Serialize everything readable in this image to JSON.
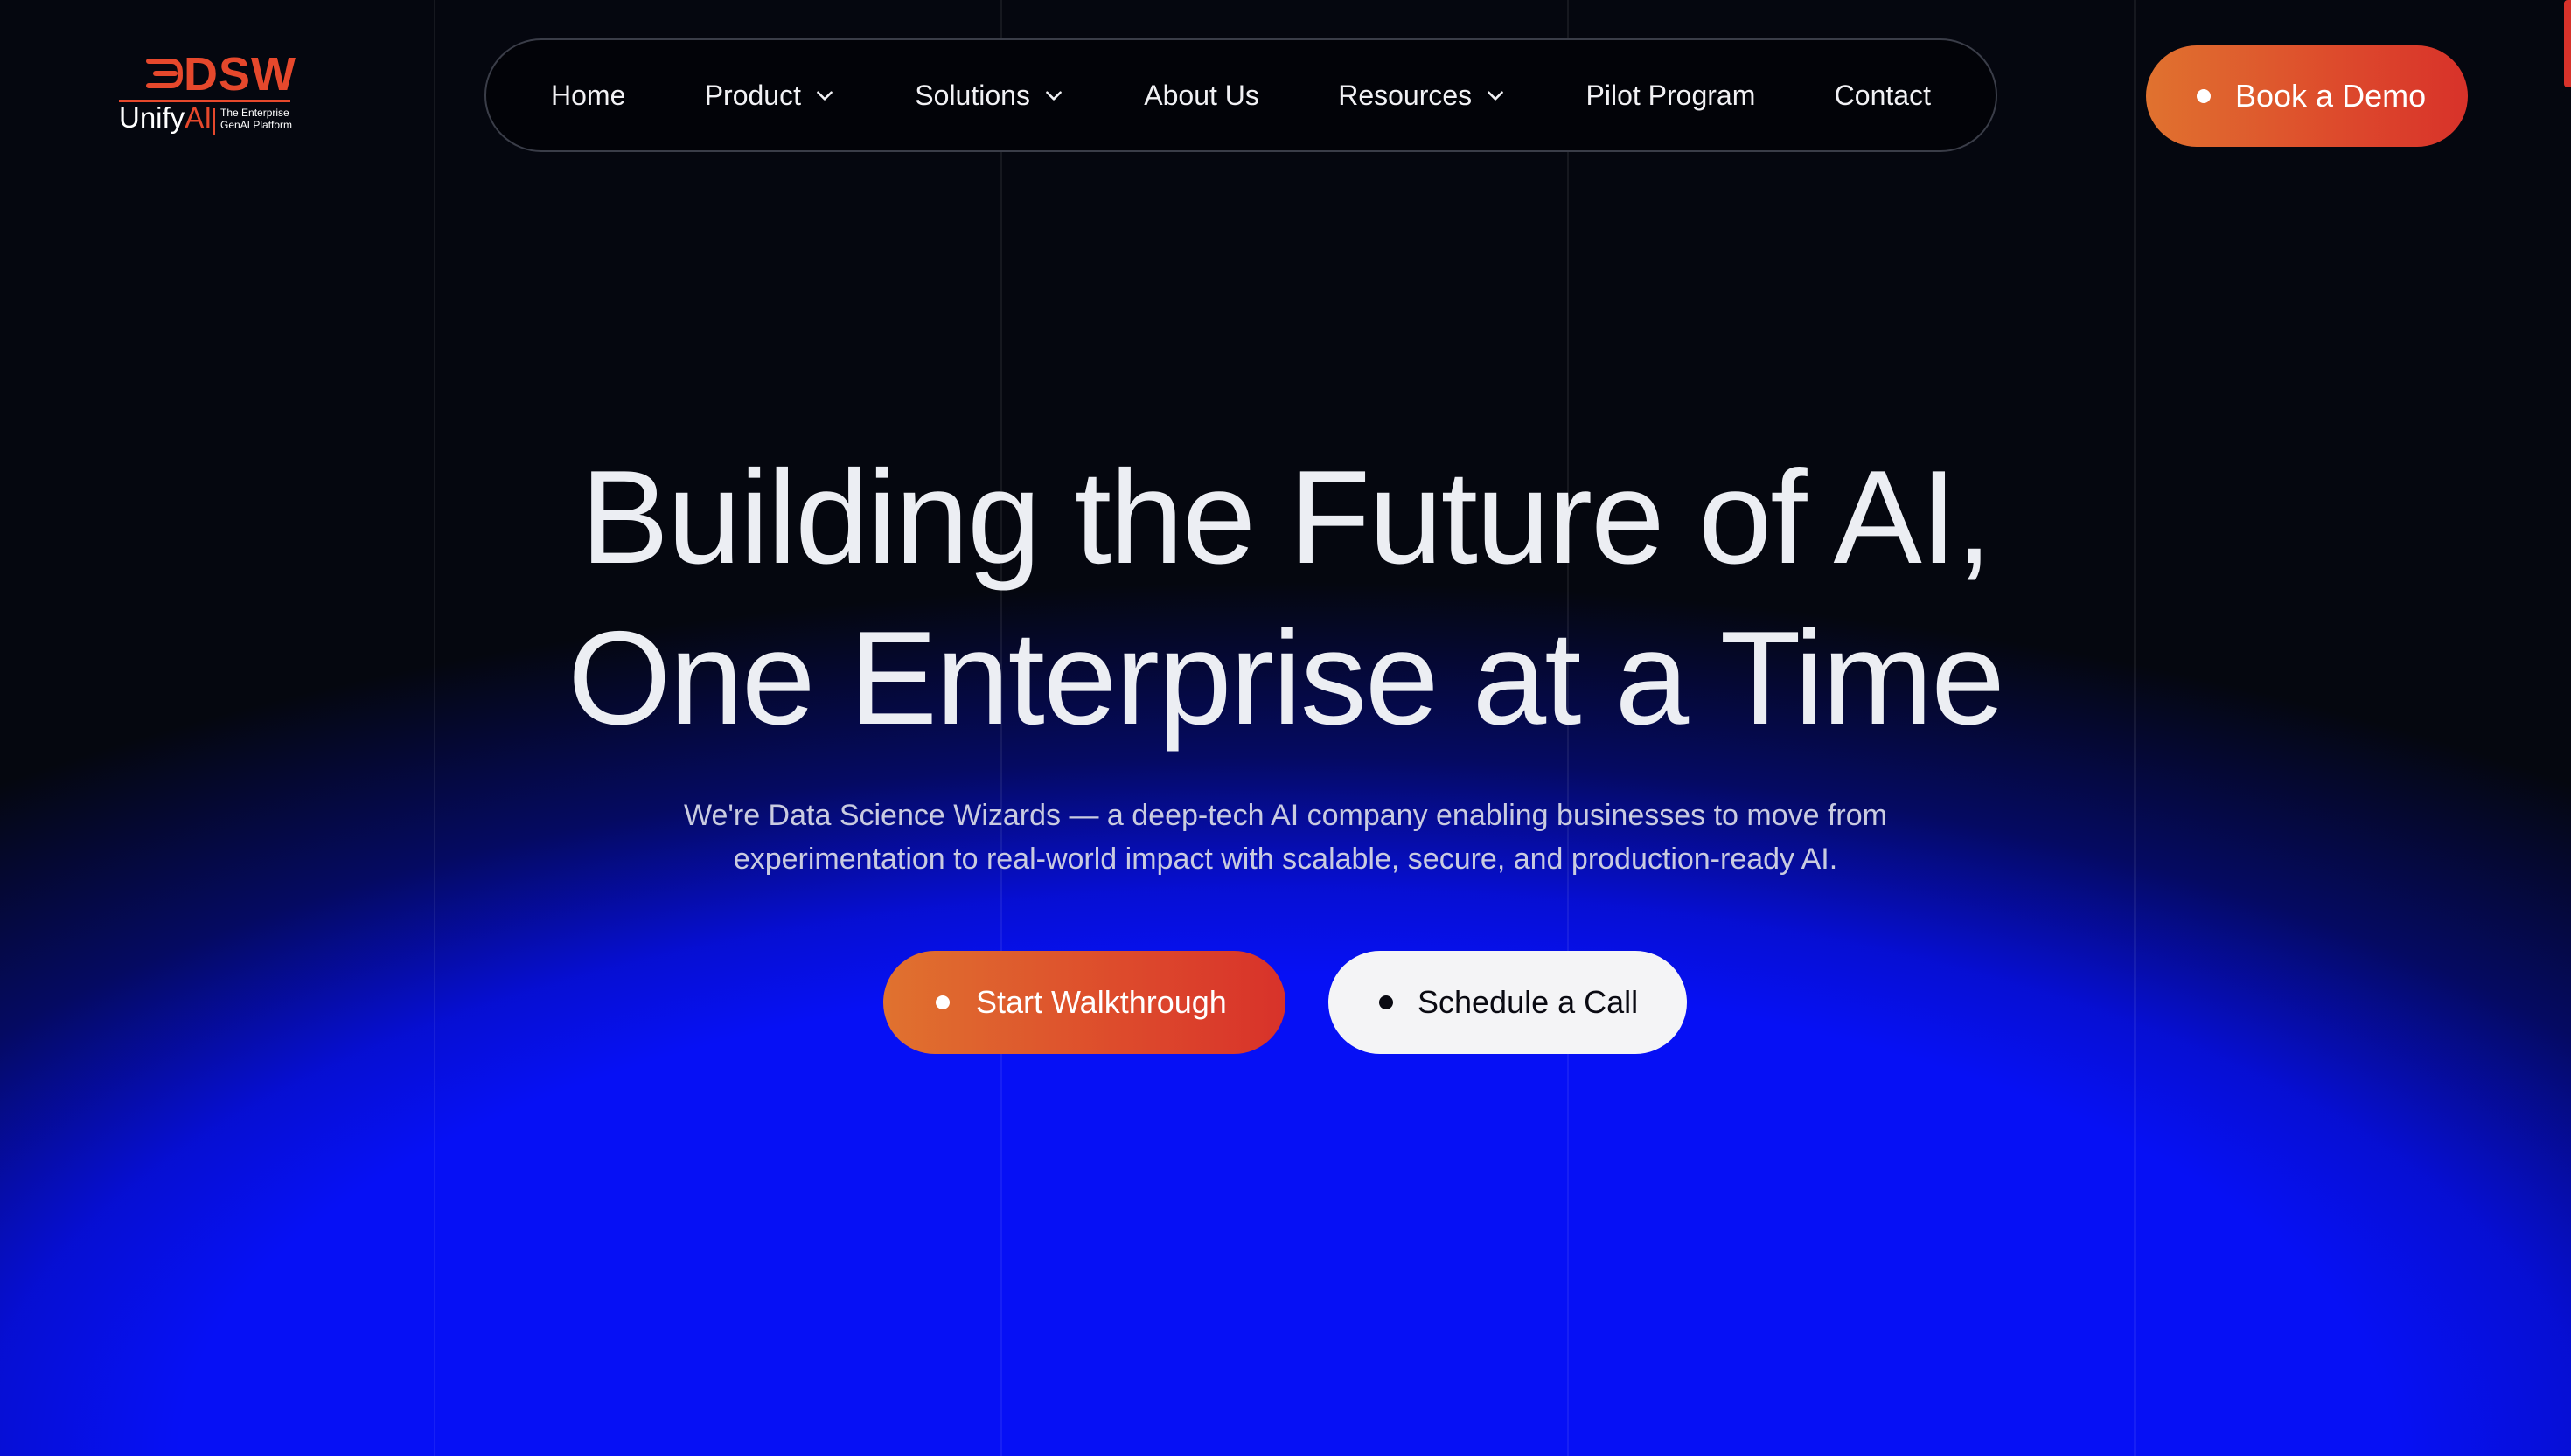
{
  "logo": {
    "mark_text": "DSW",
    "brand_prefix": "Unify",
    "brand_suffix": "AI",
    "tagline": "The Enterprise GenAI Platform"
  },
  "nav": {
    "items": [
      {
        "label": "Home",
        "has_dropdown": false
      },
      {
        "label": "Product",
        "has_dropdown": true
      },
      {
        "label": "Solutions",
        "has_dropdown": true
      },
      {
        "label": "About Us",
        "has_dropdown": false
      },
      {
        "label": "Resources",
        "has_dropdown": true
      },
      {
        "label": "Pilot Program",
        "has_dropdown": false
      },
      {
        "label": "Contact",
        "has_dropdown": false
      }
    ]
  },
  "header": {
    "cta_label": "Book a Demo"
  },
  "hero": {
    "title_line1": "Building the Future of AI,",
    "title_line2": "One Enterprise at a Time",
    "subtitle_line1": "We're Data Science Wizards — a deep-tech AI company enabling businesses to move from",
    "subtitle_line2": "experimentation to real-world impact with scalable, secure, and production-ready AI.",
    "primary_cta": "Start Walkthrough",
    "secondary_cta": "Schedule a Call"
  },
  "colors": {
    "background": "#05070f",
    "glow_blue": "#0610f5",
    "accent_orange": "#e0722f",
    "accent_red": "#d8322a"
  }
}
